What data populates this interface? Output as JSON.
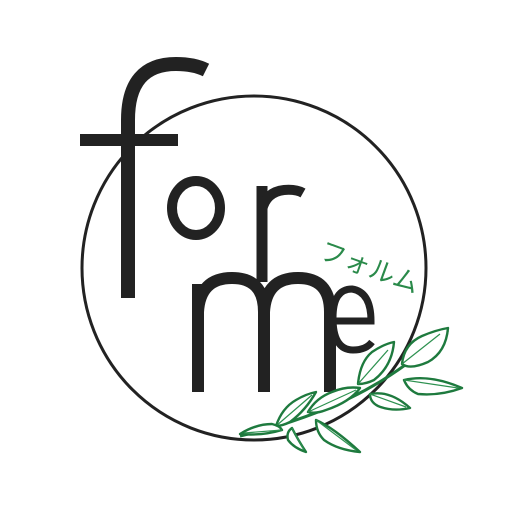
{
  "logo": {
    "wordmark_letters": [
      "f",
      "o",
      "r",
      "m",
      "e"
    ],
    "katakana": "フォルム",
    "colors": {
      "background": "#ffffff",
      "ink": "#222222",
      "ring": "#222222",
      "katakana": "#2a8a4a",
      "leaf_fill": "#ffffff",
      "leaf_stroke": "#1e7a3e",
      "leaf_vein": "#2d9150"
    },
    "decoration": "leafy-branch"
  }
}
